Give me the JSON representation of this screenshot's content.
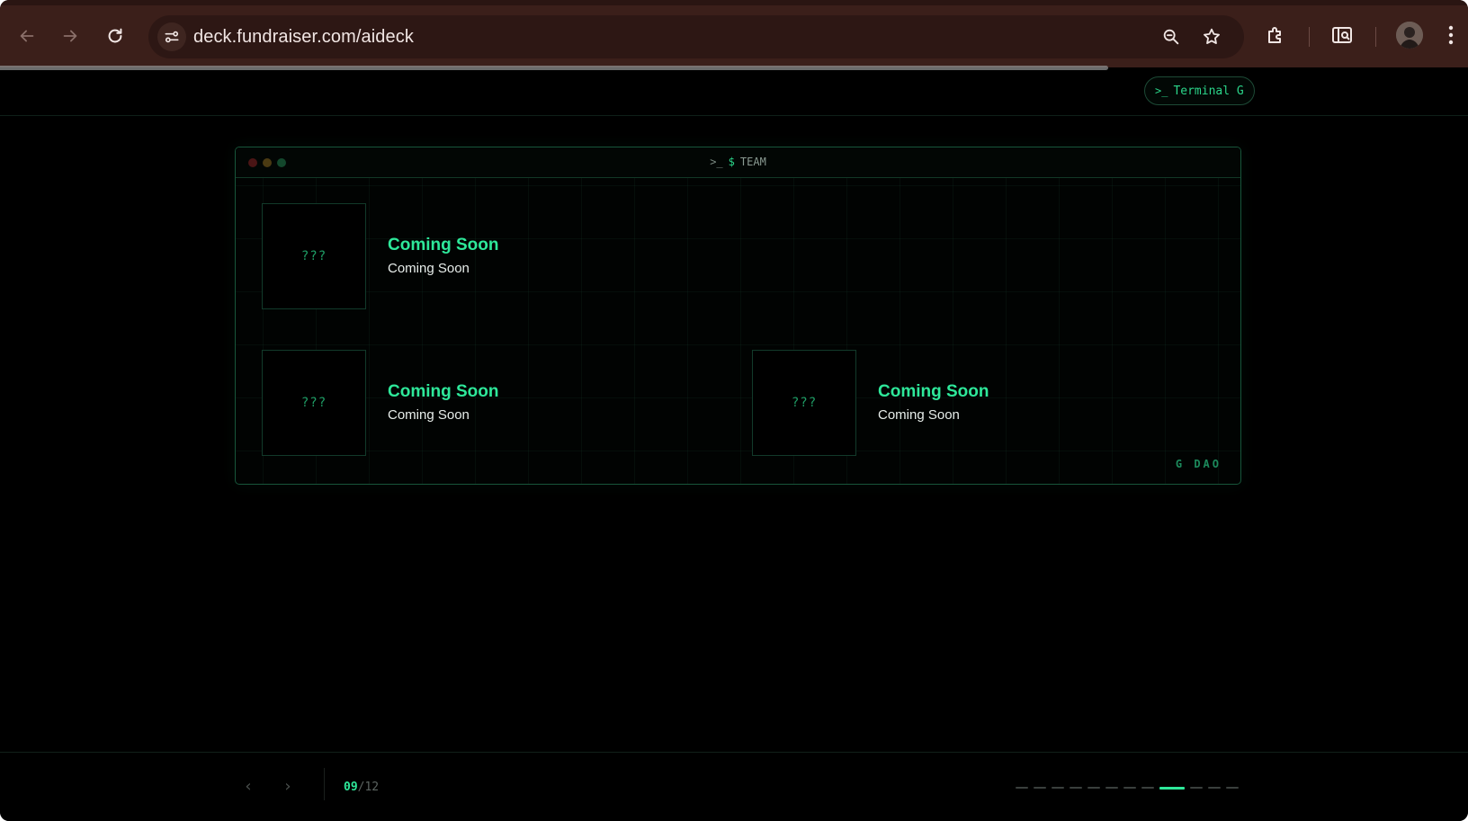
{
  "browser": {
    "url": "deck.fundraiser.com/aideck",
    "icons": {
      "back": "back-arrow-icon",
      "forward": "forward-arrow-icon",
      "reload": "reload-icon",
      "site_info": "site-settings-icon",
      "zoom": "zoom-icon",
      "bookmark": "star-icon",
      "extensions": "puzzle-icon",
      "side_panel": "search-panel-icon",
      "menu": "kebab-menu-icon"
    }
  },
  "page": {
    "terminal_button_label": "Terminal G",
    "window": {
      "title": "TEAM",
      "prompt_symbol": "$",
      "brand": "G DAO"
    },
    "team": [
      {
        "avatar": "???",
        "name": "Coming Soon",
        "role": "Coming Soon"
      },
      {
        "avatar": "???",
        "name": "Coming Soon",
        "role": "Coming Soon"
      },
      {
        "avatar": "???",
        "name": "Coming Soon",
        "role": "Coming Soon"
      }
    ],
    "pagination": {
      "current": "09",
      "total": "/12",
      "current_index": 9,
      "slide_count": 12
    }
  },
  "colors": {
    "accent": "#2ee89a",
    "chrome": "#3b1f1a",
    "background": "#000000"
  }
}
